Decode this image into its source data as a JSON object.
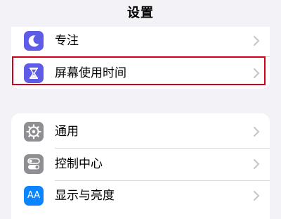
{
  "header": {
    "title": "设置"
  },
  "groups": [
    {
      "items": [
        {
          "label": "专注",
          "icon": "moon-icon",
          "icon_color": "#5e5ce6"
        },
        {
          "label": "屏幕使用时间",
          "icon": "hourglass-icon",
          "icon_color": "#5e5ce6"
        }
      ]
    },
    {
      "items": [
        {
          "label": "通用",
          "icon": "gear-icon",
          "icon_color": "#8e8e93"
        },
        {
          "label": "控制中心",
          "icon": "toggle-switches-icon",
          "icon_color": "#8e8e93"
        },
        {
          "label": "显示与亮度",
          "icon": "text-size-icon",
          "icon_color": "#0a84ff",
          "icon_text": "AA"
        }
      ]
    }
  ],
  "highlight": {
    "target": "屏幕使用时间",
    "color": "#d0021b"
  }
}
